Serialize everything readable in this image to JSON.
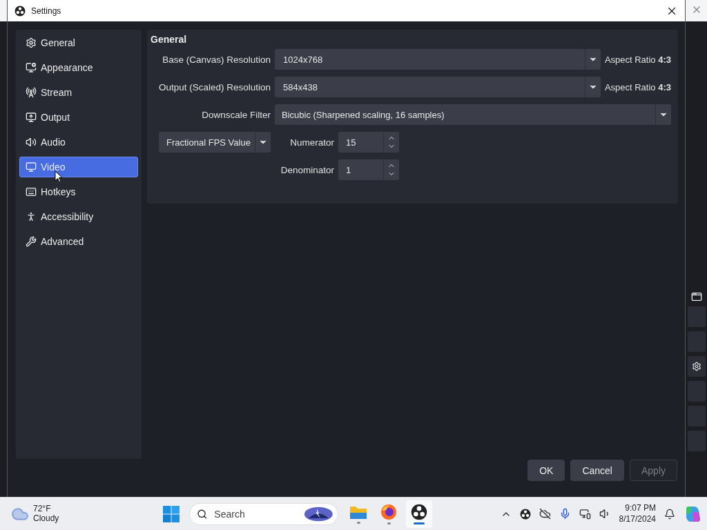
{
  "window": {
    "title": "Settings"
  },
  "sidebar": {
    "items": [
      {
        "label": "General",
        "selected": false
      },
      {
        "label": "Appearance",
        "selected": false
      },
      {
        "label": "Stream",
        "selected": false
      },
      {
        "label": "Output",
        "selected": false
      },
      {
        "label": "Audio",
        "selected": false
      },
      {
        "label": "Video",
        "selected": true
      },
      {
        "label": "Hotkeys",
        "selected": false
      },
      {
        "label": "Accessibility",
        "selected": false
      },
      {
        "label": "Advanced",
        "selected": false
      }
    ]
  },
  "section": {
    "title": "General",
    "resolutions": [
      {
        "label": "Base (Canvas) Resolution",
        "value": "1024x768",
        "aspect": "Aspect Ratio **4:3**"
      },
      {
        "label": "Output (Scaled) Resolution",
        "value": "584x438",
        "aspect": "Aspect Ratio **4:3**"
      }
    ],
    "downscale": {
      "label": "Downscale Filter",
      "value": "Bicubic (Sharpened scaling, 16 samples)"
    },
    "fps_type": {
      "value": "Fractional FPS Value"
    },
    "spinners": [
      {
        "label": "Numerator",
        "value": "15"
      },
      {
        "label": "Denominator",
        "value": "1"
      }
    ]
  },
  "buttons": [
    {
      "label": "OK",
      "disabled": false
    },
    {
      "label": "Cancel",
      "disabled": false
    },
    {
      "label": "Apply",
      "disabled": true
    }
  ],
  "taskbar": {
    "weather": {
      "temperature": "72°F",
      "condition": "Cloudy"
    },
    "search": {
      "placeholder": "Search"
    },
    "apps": [
      {
        "kind": "folder",
        "active": false
      },
      {
        "kind": "browser",
        "active": false
      },
      {
        "kind": "recorder",
        "active": true
      }
    ],
    "time": "9:07 PM",
    "date": "8/17/2024"
  }
}
